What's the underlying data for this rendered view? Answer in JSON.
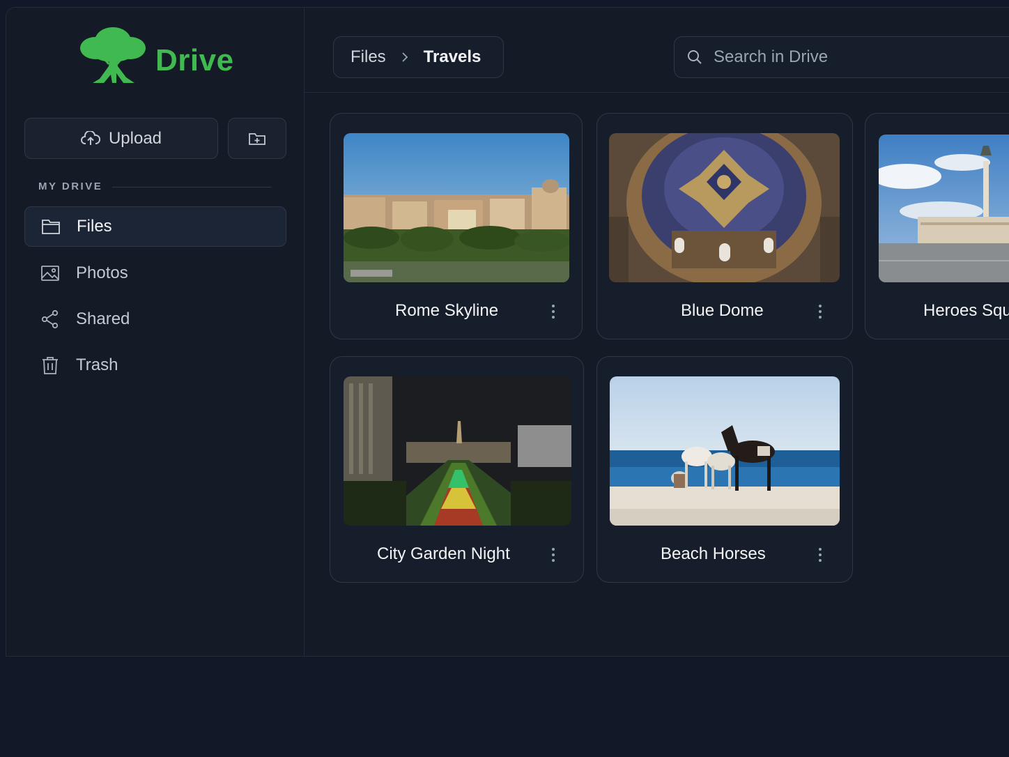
{
  "app": {
    "name": "Drive",
    "brand_color": "#3fb950"
  },
  "sidebar": {
    "upload_label": "Upload",
    "upload_icon": "cloud-upload-icon",
    "new_folder_icon": "folder-plus-icon",
    "section_label": "MY DRIVE",
    "items": [
      {
        "label": "Files",
        "icon": "folder-icon",
        "active": true
      },
      {
        "label": "Photos",
        "icon": "image-icon",
        "active": false
      },
      {
        "label": "Shared",
        "icon": "share-icon",
        "active": false
      },
      {
        "label": "Trash",
        "icon": "trash-icon",
        "active": false
      }
    ]
  },
  "header": {
    "breadcrumb": [
      "Files",
      "Travels"
    ],
    "search_placeholder": "Search in Drive"
  },
  "files": [
    {
      "title": "Rome Skyline",
      "thumbnail": "city skyline"
    },
    {
      "title": "Blue Dome",
      "thumbnail": "ornate dome ceiling"
    },
    {
      "title": "Heroes Squ",
      "thumbnail": "monument square"
    },
    {
      "title": "City Garden Night",
      "thumbnail": "night garden"
    },
    {
      "title": "Beach Horses",
      "thumbnail": "horses on beach"
    }
  ]
}
